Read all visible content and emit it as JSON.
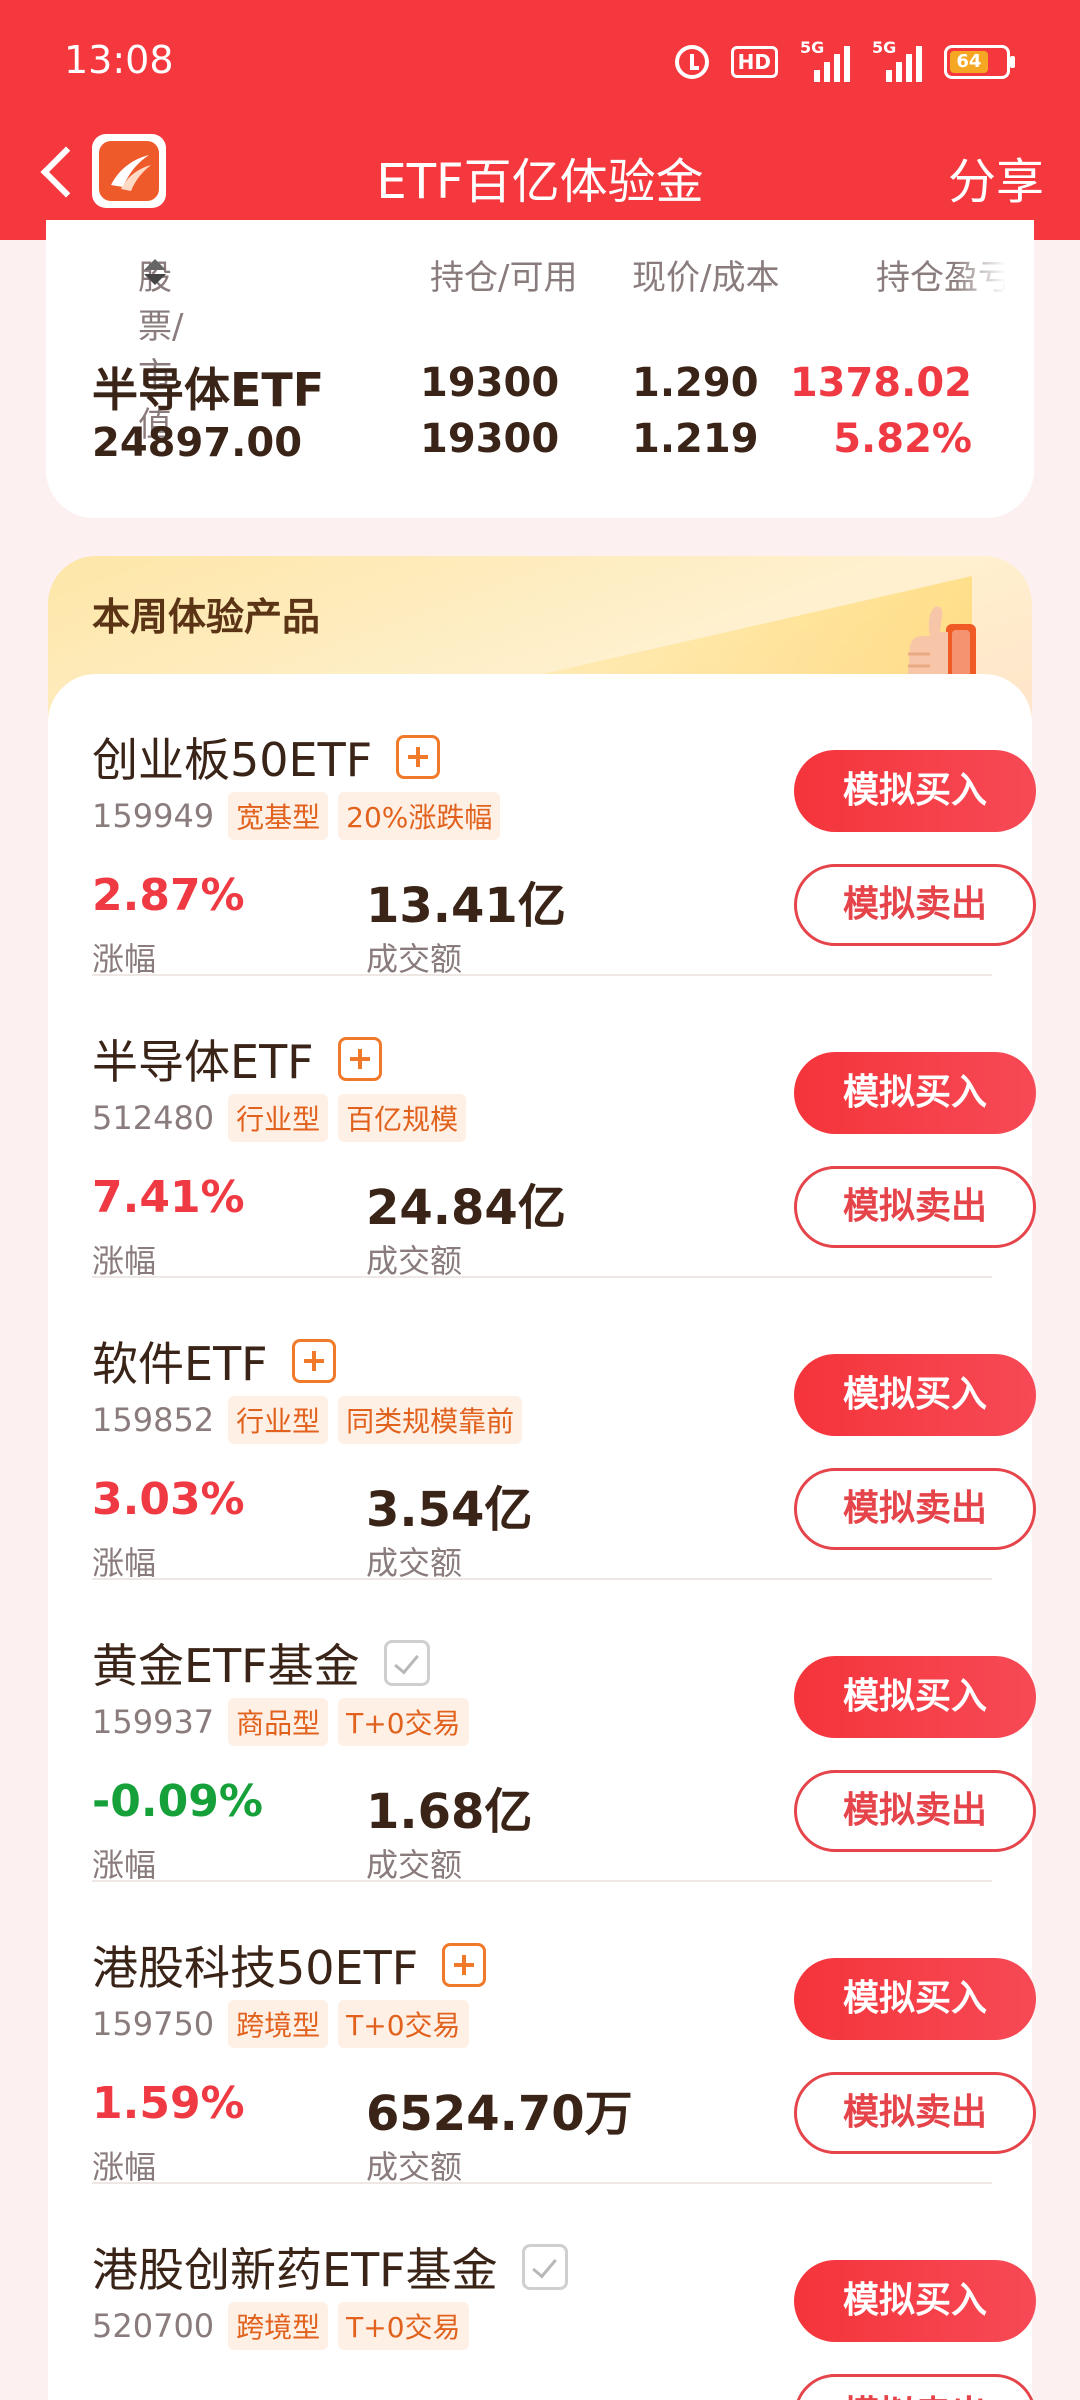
{
  "status_bar": {
    "time": "13:08",
    "hd": "HD",
    "net1": "5G",
    "net2": "5G",
    "battery": "64"
  },
  "header": {
    "title": "ETF百亿体验金",
    "share": "分享"
  },
  "holdings": {
    "headers": {
      "stock": "股票/市值",
      "position": "持仓/可用",
      "price": "现价/成本",
      "pnl": "持仓盈亏"
    },
    "row": {
      "name": "半导体ETF",
      "market_value": "24897.00",
      "position": "19300",
      "available": "19300",
      "price": "1.290",
      "cost": "1.219",
      "pnl": "1378.02",
      "pnl_pct": "5.82%"
    }
  },
  "section": {
    "title": "本周体验产品"
  },
  "products": [
    {
      "name": "创业板50ETF",
      "added": false,
      "code": "159949",
      "tags": [
        "宽基型",
        "20%涨跌幅"
      ],
      "change": "2.87%",
      "change_label": "涨幅",
      "direction": "up",
      "amount": "13.41亿",
      "amount_label": "成交额",
      "buy": "模拟买入",
      "sell": "模拟卖出"
    },
    {
      "name": "半导体ETF",
      "added": false,
      "code": "512480",
      "tags": [
        "行业型",
        "百亿规模"
      ],
      "change": "7.41%",
      "change_label": "涨幅",
      "direction": "up",
      "amount": "24.84亿",
      "amount_label": "成交额",
      "buy": "模拟买入",
      "sell": "模拟卖出"
    },
    {
      "name": "软件ETF",
      "added": false,
      "code": "159852",
      "tags": [
        "行业型",
        "同类规模靠前"
      ],
      "change": "3.03%",
      "change_label": "涨幅",
      "direction": "up",
      "amount": "3.54亿",
      "amount_label": "成交额",
      "buy": "模拟买入",
      "sell": "模拟卖出"
    },
    {
      "name": "黄金ETF基金",
      "added": true,
      "code": "159937",
      "tags": [
        "商品型",
        "T+0交易"
      ],
      "change": "-0.09%",
      "change_label": "涨幅",
      "direction": "down",
      "amount": "1.68亿",
      "amount_label": "成交额",
      "buy": "模拟买入",
      "sell": "模拟卖出"
    },
    {
      "name": "港股科技50ETF",
      "added": false,
      "code": "159750",
      "tags": [
        "跨境型",
        "T+0交易"
      ],
      "change": "1.59%",
      "change_label": "涨幅",
      "direction": "up",
      "amount": "6524.70万",
      "amount_label": "成交额",
      "buy": "模拟买入",
      "sell": "模拟卖出"
    },
    {
      "name": "港股创新药ETF基金",
      "added": true,
      "code": "520700",
      "tags": [
        "跨境型",
        "T+0交易"
      ],
      "change": "",
      "change_label": "",
      "direction": "up",
      "amount": "",
      "amount_label": "",
      "buy": "模拟买入",
      "sell": "模拟卖出"
    }
  ],
  "colors": {
    "brand": "#f5383e",
    "up": "#ef3a43",
    "down": "#15a03a",
    "tag_text": "#e0621d"
  }
}
